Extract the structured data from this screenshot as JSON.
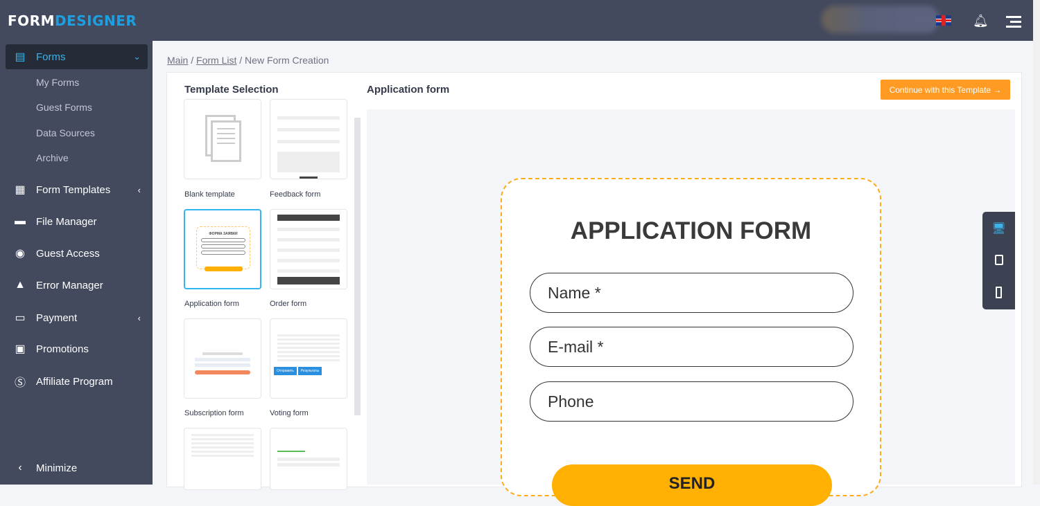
{
  "app": {
    "logo_a": "FORM",
    "logo_b": "DESIGNER"
  },
  "sidebar": {
    "items": [
      {
        "label": "Forms",
        "icon": "forms-icon"
      },
      {
        "label": "Form Templates",
        "icon": "templates-icon"
      },
      {
        "label": "File Manager",
        "icon": "file-manager-icon"
      },
      {
        "label": "Guest Access",
        "icon": "user-icon"
      },
      {
        "label": "Error Manager",
        "icon": "warning-icon"
      },
      {
        "label": "Payment",
        "icon": "card-icon"
      },
      {
        "label": "Promotions",
        "icon": "gift-icon"
      },
      {
        "label": "Affiliate Program",
        "icon": "dollar-icon"
      }
    ],
    "sub": [
      "My Forms",
      "Guest Forms",
      "Data Sources",
      "Archive"
    ],
    "minimize": "Minimize"
  },
  "breadcrumb": {
    "main": "Main",
    "list": "Form List",
    "current": "New Form Creation",
    "sep": "/"
  },
  "panel": {
    "title": "Template Selection",
    "preview_title": "Application form",
    "continue": "Continue with this Template →"
  },
  "templates": [
    "Blank template",
    "Feedback form",
    "Application form",
    "Order form",
    "Subscription form",
    "Voting form"
  ],
  "thumb_text": {
    "app_title": "ФОРМА ЗАЯВКИ",
    "send": "Отправить",
    "results": "Результаты"
  },
  "preview": {
    "title": "APPLICATION FORM",
    "fields": [
      "Name *",
      "E-mail *",
      "Phone"
    ],
    "send": "SEND"
  }
}
